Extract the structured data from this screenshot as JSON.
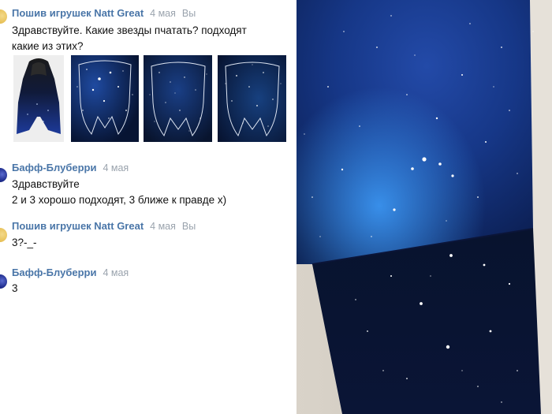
{
  "messages": [
    {
      "author": "Пошив игрушек Natt Great",
      "time": "4 мая",
      "you": "Вы",
      "lines": [
        "Здравствуйте. Какие звезды пчатать? подходят",
        "какие из этих?"
      ]
    },
    {
      "author": "Бафф-Блуберри",
      "time": "4 мая",
      "lines": [
        "Здравствуйте",
        "2 и 3 хорошо подходят, 3 ближе к правде х)"
      ]
    },
    {
      "author": "Пошив игрушек Natt Great",
      "time": "4 мая",
      "you": "Вы",
      "lines": [
        "3?-_-"
      ]
    },
    {
      "author": "Бафф-Блуберри",
      "time": "4 мая",
      "lines": [
        "3"
      ]
    }
  ],
  "attachments": [
    "hooded-cape-photo",
    "star-print-1",
    "star-print-2",
    "star-print-3"
  ],
  "colors": {
    "author": "#4a76a8",
    "meta": "#9aa3ad",
    "text": "#111111"
  }
}
